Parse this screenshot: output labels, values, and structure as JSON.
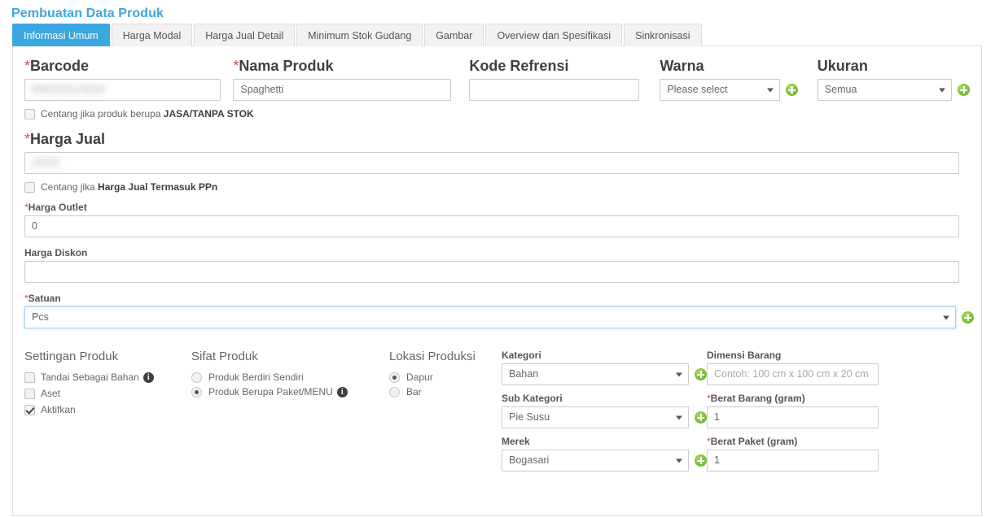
{
  "page": {
    "title": "Pembuatan Data Produk"
  },
  "tabs": [
    {
      "label": "Informasi Umum",
      "active": true
    },
    {
      "label": "Harga Modal",
      "active": false
    },
    {
      "label": "Harga Jual Detail",
      "active": false
    },
    {
      "label": "Minimum Stok Gudang",
      "active": false
    },
    {
      "label": "Gambar",
      "active": false
    },
    {
      "label": "Overview dan Spesifikasi",
      "active": false
    },
    {
      "label": "Sinkronisasi",
      "active": false
    }
  ],
  "form": {
    "barcode": {
      "label": "Barcode",
      "required": true,
      "value": "8991002103016",
      "redacted": true
    },
    "nama_produk": {
      "label": "Nama Produk",
      "required": true,
      "value": "Spaghetti"
    },
    "kode_refrensi": {
      "label": "Kode Refrensi",
      "required": false,
      "value": ""
    },
    "warna": {
      "label": "Warna",
      "required": false,
      "value": "Please select"
    },
    "ukuran": {
      "label": "Ukuran",
      "required": false,
      "value": "Semua"
    },
    "jasa_checkbox": {
      "prefix": "Centang jika produk berupa ",
      "strong": "JASA/TANPA STOK",
      "checked": false
    },
    "harga_jual": {
      "label": "Harga Jual",
      "required": true,
      "value": "25000",
      "redacted": true
    },
    "ppn_checkbox": {
      "prefix": "Centang jika ",
      "strong": "Harga Jual Termasuk PPn",
      "checked": false
    },
    "harga_outlet": {
      "label": "Harga Outlet",
      "required": true,
      "value": "0"
    },
    "harga_diskon": {
      "label": "Harga Diskon",
      "required": false,
      "value": ""
    },
    "satuan": {
      "label": "Satuan",
      "required": true,
      "value": "Pcs",
      "focused": true
    }
  },
  "settingan_produk": {
    "heading": "Settingan Produk",
    "items": [
      {
        "label": "Tandai Sebagai Bahan",
        "checked": false,
        "info": true
      },
      {
        "label": "Aset",
        "checked": false,
        "info": false
      },
      {
        "label": "Aktifkan",
        "checked": true,
        "info": false
      }
    ]
  },
  "sifat_produk": {
    "heading": "Sifat Produk",
    "items": [
      {
        "label": "Produk Berdiri Sendiri",
        "selected": false,
        "info": false
      },
      {
        "label": "Produk Berupa Paket/MENU",
        "selected": true,
        "info": true
      }
    ]
  },
  "lokasi_produksi": {
    "heading": "Lokasi Produksi",
    "items": [
      {
        "label": "Dapur",
        "selected": true
      },
      {
        "label": "Bar",
        "selected": false
      }
    ]
  },
  "kategori_group": {
    "kategori": {
      "label": "Kategori",
      "value": "Bahan"
    },
    "sub_kategori": {
      "label": "Sub Kategori",
      "value": "Pie Susu"
    },
    "merek": {
      "label": "Merek",
      "value": "Bogasari"
    }
  },
  "dimensi_group": {
    "dimensi_barang": {
      "label": "Dimensi Barang",
      "required": false,
      "value": "",
      "placeholder": "Contoh: 100 cm x 100 cm x 20 cm"
    },
    "berat_barang": {
      "label": "Berat Barang (gram)",
      "required": true,
      "value": "1"
    },
    "berat_paket": {
      "label": "Berat Paket (gram)",
      "required": true,
      "value": "1"
    }
  },
  "icons": {
    "add": "plus-circle-icon",
    "info": "info-circle-icon",
    "caret": "chevron-down-icon"
  },
  "colors": {
    "accent_blue": "#3ba7e0",
    "add_green": "#7ac143",
    "required_red": "#d94a4a",
    "border_gray": "#dcdcdc"
  }
}
